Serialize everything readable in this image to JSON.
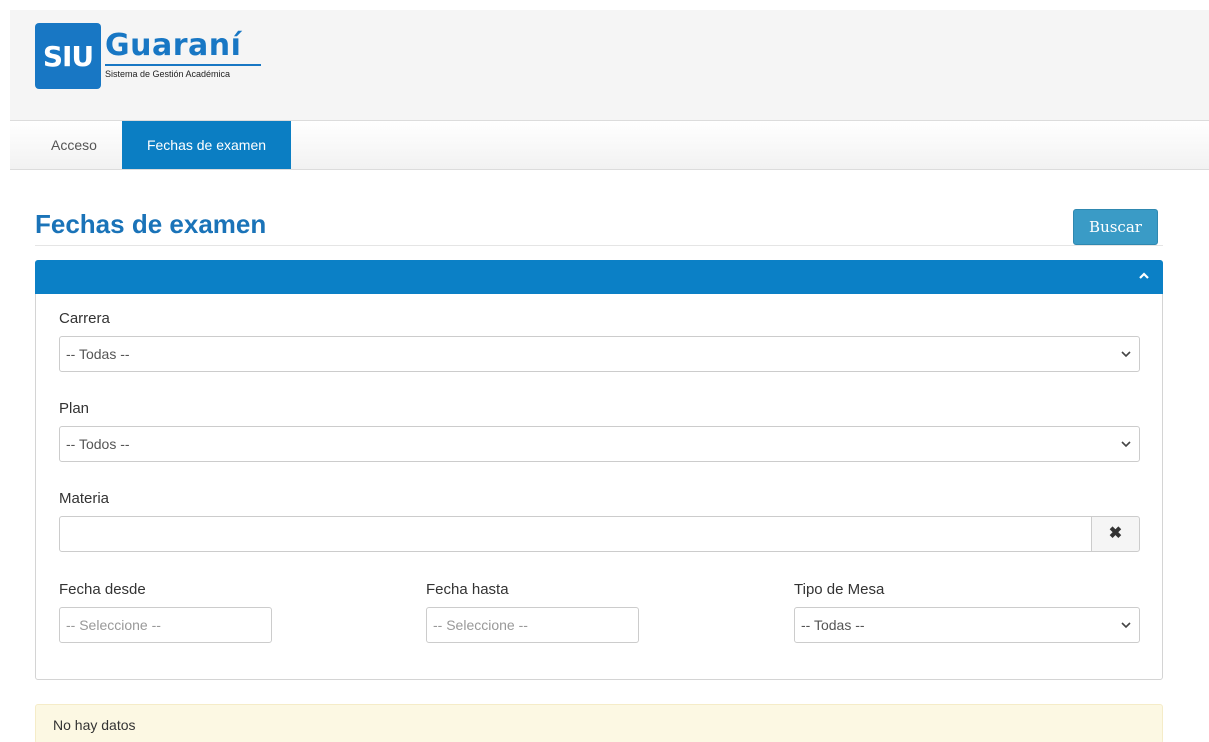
{
  "brand": {
    "logo_mark": "SIU",
    "logo_name": "Guaraní",
    "logo_subtitle": "Sistema de Gestión Académica",
    "color": "#1877c4"
  },
  "nav": {
    "items": [
      {
        "label": "Acceso",
        "active": false
      },
      {
        "label": "Fechas de examen",
        "active": true
      }
    ],
    "active_color": "#0b7ec3"
  },
  "page": {
    "title": "Fechas de examen",
    "search_button": "Buscar"
  },
  "filters": {
    "panel_toggle_icon": "chevron-up-icon",
    "carrera": {
      "label": "Carrera",
      "value": "-- Todas --"
    },
    "plan": {
      "label": "Plan",
      "value": "-- Todos --"
    },
    "materia": {
      "label": "Materia",
      "value": "",
      "clear_icon": "times-icon"
    },
    "fecha_desde": {
      "label": "Fecha desde",
      "placeholder": "-- Seleccione --"
    },
    "fecha_hasta": {
      "label": "Fecha hasta",
      "placeholder": "-- Seleccione --"
    },
    "tipo_mesa": {
      "label": "Tipo de Mesa",
      "value": "-- Todas --"
    }
  },
  "results": {
    "message": "No hay datos",
    "background": "#fcf8e3"
  }
}
